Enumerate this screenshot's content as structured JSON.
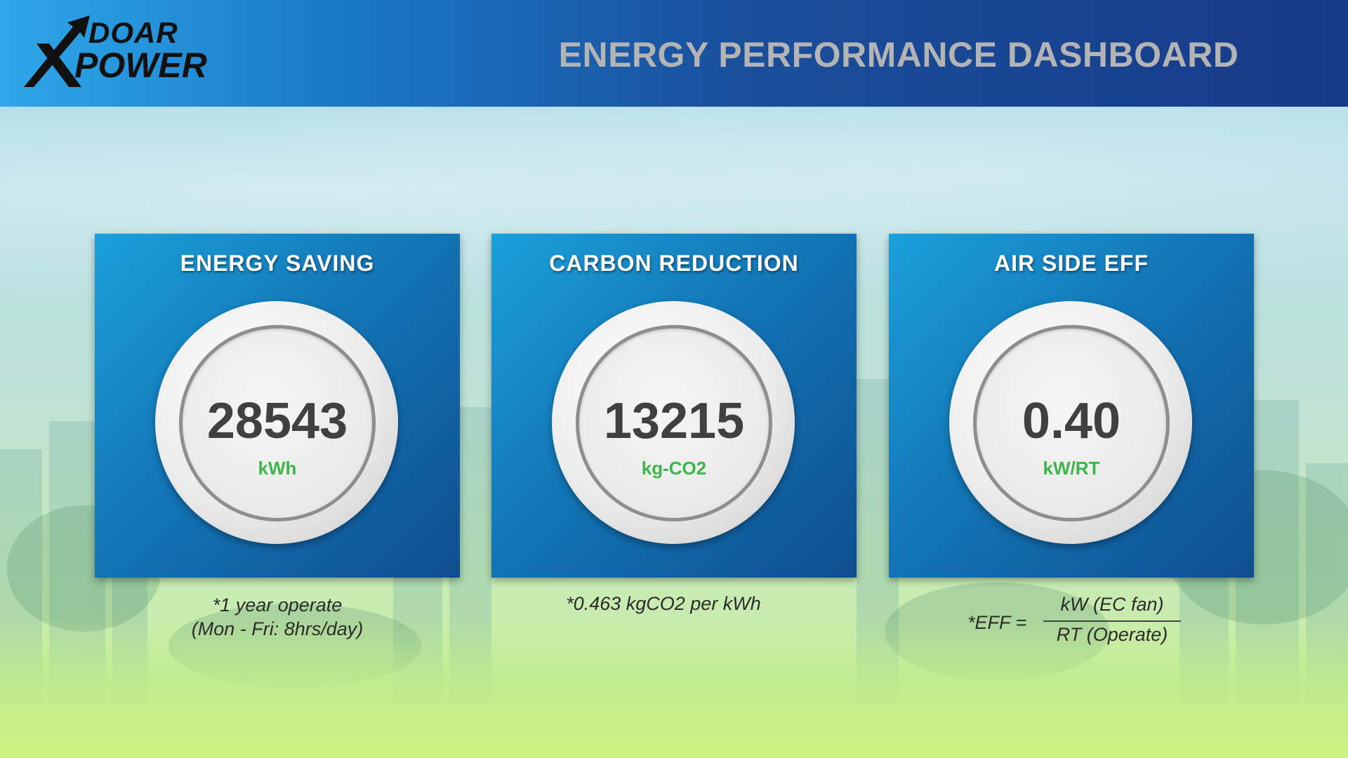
{
  "header": {
    "logo_top": "DOAR",
    "logo_bottom": "POWER",
    "title": "ENERGY PERFORMANCE DASHBOARD"
  },
  "cards": [
    {
      "title": "ENERGY SAVING",
      "value": "28543",
      "unit": "kWh",
      "note_line1": "*1 year operate",
      "note_line2": "(Mon - Fri: 8hrs/day)"
    },
    {
      "title": "CARBON REDUCTION",
      "value": "13215",
      "unit": "kg-CO2",
      "note_line1": "*0.463 kgCO2 per kWh"
    },
    {
      "title": "AIR SIDE EFF",
      "value": "0.40",
      "unit": "kW/RT",
      "formula_label": "*EFF =",
      "formula_numerator": "kW (EC fan)",
      "formula_denominator": "RT (Operate)"
    }
  ],
  "colors": {
    "header_start": "#2ea7e8",
    "header_end": "#173a86",
    "card_start": "#1ba0db",
    "card_end": "#0f4e8f",
    "unit_green": "#3cb54a",
    "value_text": "#404040",
    "title_gray": "#b4b4b4"
  },
  "icons": {
    "logo_mark": "x-arrow-logo-icon"
  }
}
